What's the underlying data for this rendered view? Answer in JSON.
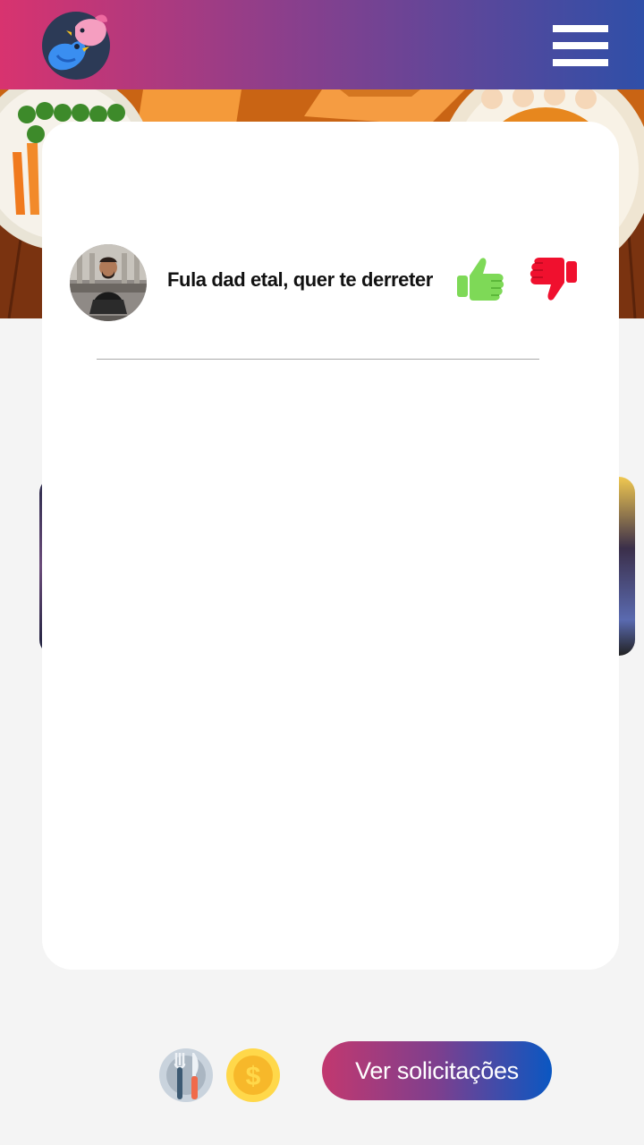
{
  "header": {
    "logo_icon": "birds-logo-icon",
    "menu_icon": "hamburger-menu-icon"
  },
  "banner": {
    "image": "food-table-banner"
  },
  "notification": {
    "text": "Fula dad etal, quer te derreter",
    "avatar": "user-avatar-photo",
    "accept_icon": "thumbs-up-icon",
    "reject_icon": "thumbs-down-icon"
  },
  "bottom": {
    "food_icon": "fork-knife-plate-icon",
    "coin_icon": "dollar-coin-icon",
    "ver_label": "Ver solicitações"
  },
  "colors": {
    "header_start": "#d8336f",
    "header_end": "#2f4fa8",
    "accept": "#7ed957",
    "reject": "#f0102e",
    "button_start": "#c2386f",
    "button_end": "#0a57c2"
  }
}
